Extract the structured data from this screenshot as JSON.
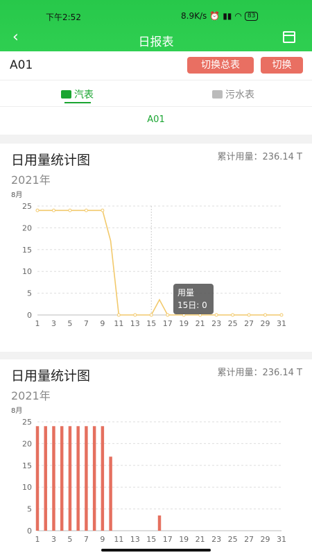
{
  "status_bar": {
    "time": "下午2:52",
    "net_speed": "8.9K/s",
    "battery": "83"
  },
  "header": {
    "title": "日报表",
    "back_icon": "back-icon",
    "calendar_icon": "calendar-icon"
  },
  "meter": {
    "name": "A01",
    "switch_total_label": "切换总表",
    "switch_label": "切换",
    "tabs": [
      {
        "label": "汽表",
        "active": true
      },
      {
        "label": "污水表",
        "active": false
      }
    ],
    "sub_name": "A01"
  },
  "colors": {
    "brand": "#2dcd4f",
    "accent": "#1aa531",
    "button": "#e96f62",
    "line": "#f2c96b",
    "bar": "#e5705f"
  },
  "charts": [
    {
      "title": "日用量统计图",
      "total": "累计用量：236.14 T",
      "year": "2021年",
      "month": "8月",
      "tooltip": {
        "series": "用量",
        "value": "15日: 0"
      }
    },
    {
      "title": "日用量统计图",
      "total": "累计用量：236.14 T",
      "year": "2021年",
      "month": "8月"
    }
  ],
  "chart_data": [
    {
      "type": "line",
      "x": [
        1,
        2,
        3,
        4,
        5,
        6,
        7,
        8,
        9,
        10,
        11,
        12,
        13,
        14,
        15,
        16,
        17,
        18,
        19,
        20,
        21,
        22,
        23,
        24,
        25,
        26,
        27,
        28,
        29,
        30,
        31
      ],
      "series": [
        {
          "values": [
            24,
            24,
            24,
            24,
            24,
            24,
            24,
            24,
            24,
            17,
            0,
            0,
            0,
            0,
            0,
            3.5,
            0,
            0,
            0,
            0,
            0,
            0,
            0,
            0,
            0,
            0,
            0,
            0,
            0,
            0,
            0
          ]
        }
      ],
      "xticks": [
        1,
        3,
        5,
        7,
        9,
        11,
        13,
        15,
        17,
        19,
        21,
        23,
        25,
        27,
        29,
        31
      ],
      "yticks": [
        0,
        5,
        10,
        15,
        20,
        25
      ],
      "ylim": [
        0,
        25
      ],
      "grid": true
    },
    {
      "type": "bar",
      "x": [
        1,
        2,
        3,
        4,
        5,
        6,
        7,
        8,
        9,
        10,
        11,
        12,
        13,
        14,
        15,
        16,
        17,
        18,
        19,
        20,
        21,
        22,
        23,
        24,
        25,
        26,
        27,
        28,
        29,
        30,
        31
      ],
      "series": [
        {
          "values": [
            24,
            24,
            24,
            24,
            24,
            24,
            24,
            24,
            24,
            17,
            0,
            0,
            0,
            0,
            0,
            3.5,
            0,
            0,
            0,
            0,
            0,
            0,
            0,
            0,
            0,
            0,
            0,
            0,
            0,
            0,
            0
          ]
        }
      ],
      "xticks": [
        1,
        3,
        5,
        7,
        9,
        11,
        13,
        15,
        17,
        19,
        21,
        23,
        25,
        27,
        29,
        31
      ],
      "yticks": [
        0,
        5,
        10,
        15,
        20,
        25
      ],
      "ylim": [
        0,
        25
      ],
      "grid": true
    }
  ]
}
